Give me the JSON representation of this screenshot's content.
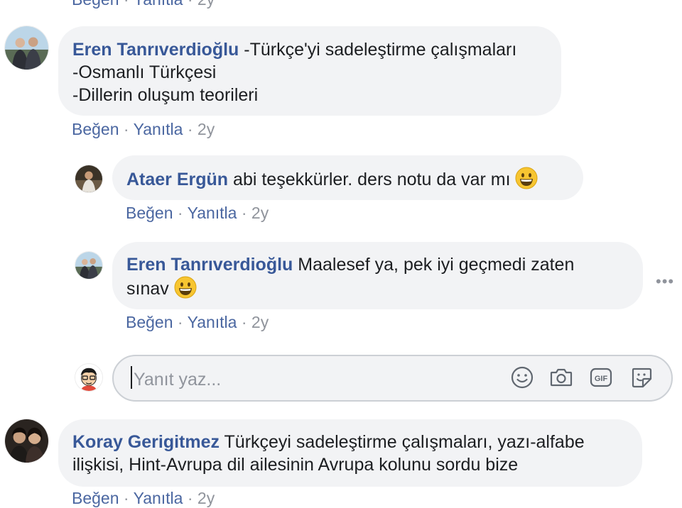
{
  "top_partial": {
    "like": "Beğen",
    "reply": "Yanıtla",
    "age": "2y"
  },
  "comments": [
    {
      "author": "Eren Tanrıverdioğlu",
      "lines": [
        "-Türkçe'yi sadeleştirme çalışmaları",
        "-Osmanlı Türkçesi",
        "-Dillerin oluşum teorileri"
      ],
      "like": "Beğen",
      "reply": "Yanıtla",
      "age": "2y"
    },
    {
      "author": "Ataer Ergün",
      "text": "abi teşekkürler. ders notu da var mı",
      "emoji": "grinning-face",
      "like": "Beğen",
      "reply": "Yanıtla",
      "age": "2y"
    },
    {
      "author": "Eren Tanrıverdioğlu",
      "lines": [
        "Maalesef ya, pek iyi geçmedi zaten",
        "sınav"
      ],
      "emoji": "grinning-face",
      "like": "Beğen",
      "reply": "Yanıtla",
      "age": "2y"
    },
    {
      "author": "Koray Gerigitmez",
      "lines": [
        "Türkçeyi sadeleştirme çalışmaları, yazı-alfabe",
        "ilişkisi, Hint-Avrupa dil ailesinin Avrupa kolunu sordu bize"
      ],
      "like": "Beğen",
      "reply": "Yanıtla",
      "age": "2y"
    }
  ],
  "reply_box": {
    "placeholder": "Yanıt yaz...",
    "icons": [
      "emoji-icon",
      "camera-icon",
      "gif-icon",
      "sticker-icon"
    ]
  },
  "separator": "·",
  "colors": {
    "author": "#385898",
    "link": "#4b67a1",
    "meta": "#90949c",
    "bubble": "#f2f3f5",
    "text": "#1c1e21"
  }
}
